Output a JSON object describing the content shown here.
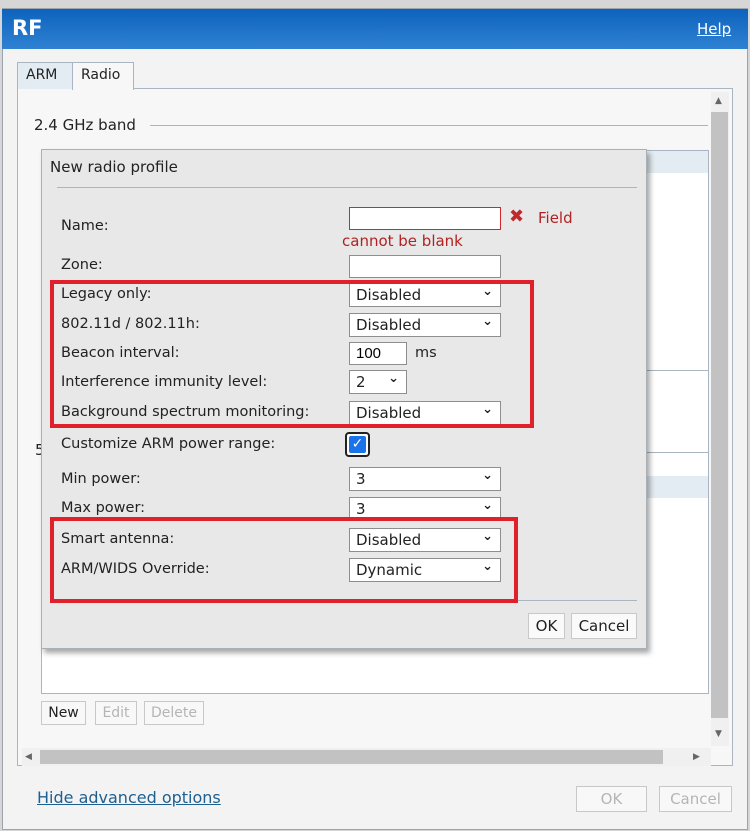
{
  "window": {
    "title": "RF",
    "help_label": "Help"
  },
  "tabs": [
    {
      "label": "ARM",
      "active": false
    },
    {
      "label": "Radio",
      "active": true
    }
  ],
  "background": {
    "band_24_label": "2.4 GHz band",
    "band_5_label": "5",
    "buttons": {
      "new": "New",
      "edit": "Edit",
      "delete": "Delete"
    }
  },
  "footer": {
    "hide_advanced": "Hide advanced options",
    "ok": "OK",
    "cancel": "Cancel"
  },
  "dialog": {
    "title": "New radio profile",
    "name": {
      "label": "Name:",
      "value": "",
      "error_prefix": "Field",
      "error_suffix": "cannot be blank"
    },
    "zone": {
      "label": "Zone:",
      "value": ""
    },
    "legacy_only": {
      "label": "Legacy only:",
      "value": "Disabled"
    },
    "dot11d": {
      "label": "802.11d / 802.11h:",
      "value": "Disabled"
    },
    "beacon": {
      "label": "Beacon interval:",
      "value": "100",
      "unit": "ms"
    },
    "interference": {
      "label": "Interference immunity level:",
      "value": "2"
    },
    "bg_spectrum": {
      "label": "Background spectrum monitoring:",
      "value": "Disabled"
    },
    "customize_arm": {
      "label": "Customize ARM power range:",
      "checked": true
    },
    "min_power": {
      "label": "Min power:",
      "value": "3"
    },
    "max_power": {
      "label": "Max power:",
      "value": "3"
    },
    "smart_antenna": {
      "label": "Smart antenna:",
      "value": "Disabled"
    },
    "arm_wids": {
      "label": "ARM/WIDS Override:",
      "value": "Dynamic"
    },
    "ok": "OK",
    "cancel": "Cancel"
  },
  "colors": {
    "title_bar": "#1565c0",
    "highlight_box": "#e0202a",
    "error": "#b22222"
  }
}
